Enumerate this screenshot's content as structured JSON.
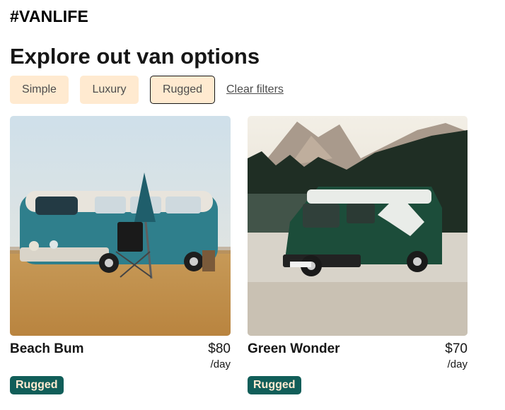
{
  "header": {
    "brand": "#VANLIFE"
  },
  "page": {
    "title": "Explore out van options"
  },
  "filters": {
    "options": [
      "Simple",
      "Luxury",
      "Rugged"
    ],
    "active": "Rugged",
    "clear_label": "Clear filters"
  },
  "vans": [
    {
      "name": "Beach Bum",
      "price": "$80",
      "per": "/day",
      "type": "Rugged"
    },
    {
      "name": "Green Wonder",
      "price": "$70",
      "per": "/day",
      "type": "Rugged"
    }
  ],
  "colors": {
    "chip_bg": "#FFEAD0",
    "badge_bg": "#115E59",
    "badge_text": "#FFEAD0",
    "text": "#161616"
  }
}
